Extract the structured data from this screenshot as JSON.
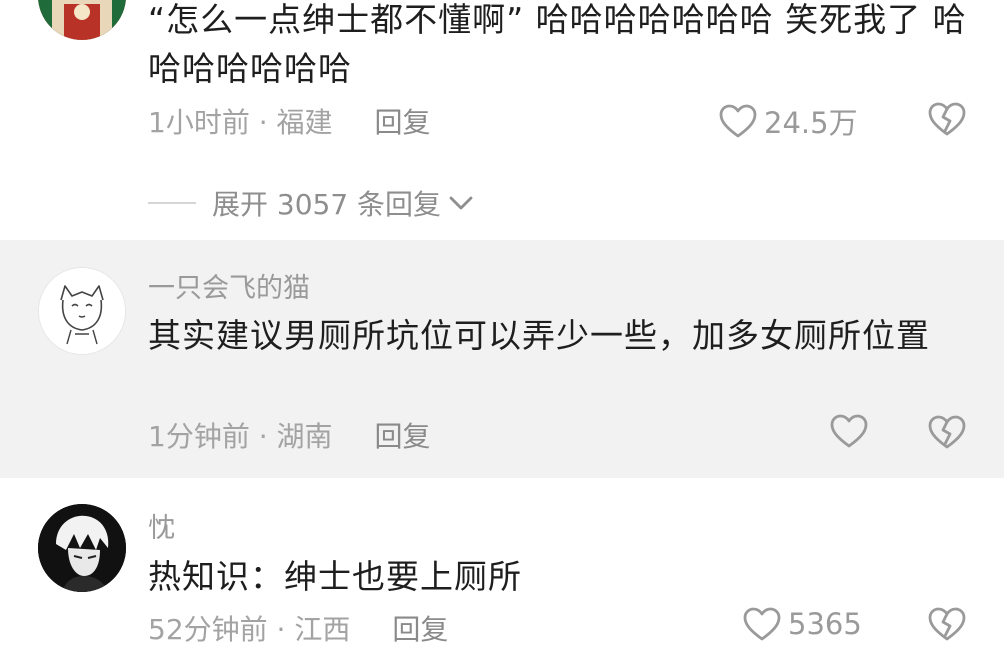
{
  "comments": [
    {
      "username": "",
      "text": "“怎么一点绅士都不懂啊” 哈哈哈哈哈哈哈 笑死我了 哈哈哈哈哈哈哈",
      "time_location": "1小时前 · 福建",
      "reply_label": "回复",
      "likes": "24.5万",
      "expand_label": "展开 3057 条回复"
    },
    {
      "username": "一只会飞的猫",
      "text": "其实建议男厕所坑位可以弄少一些，加多女厕所位置",
      "time_location": "1分钟前 · 湖南",
      "reply_label": "回复",
      "likes": ""
    },
    {
      "username": "忱",
      "text": "热知识：绅士也要上厕所",
      "time_location": "52分钟前 · 江西",
      "reply_label": "回复",
      "likes": "5365"
    }
  ],
  "icons": {
    "like": "heart-outline-icon",
    "dislike": "broken-heart-icon",
    "expand": "chevron-down-icon"
  },
  "colors": {
    "highlight_bg": "#f2f2f2",
    "meta_text": "#a3a3a3",
    "icon": "#9a9a9a"
  }
}
